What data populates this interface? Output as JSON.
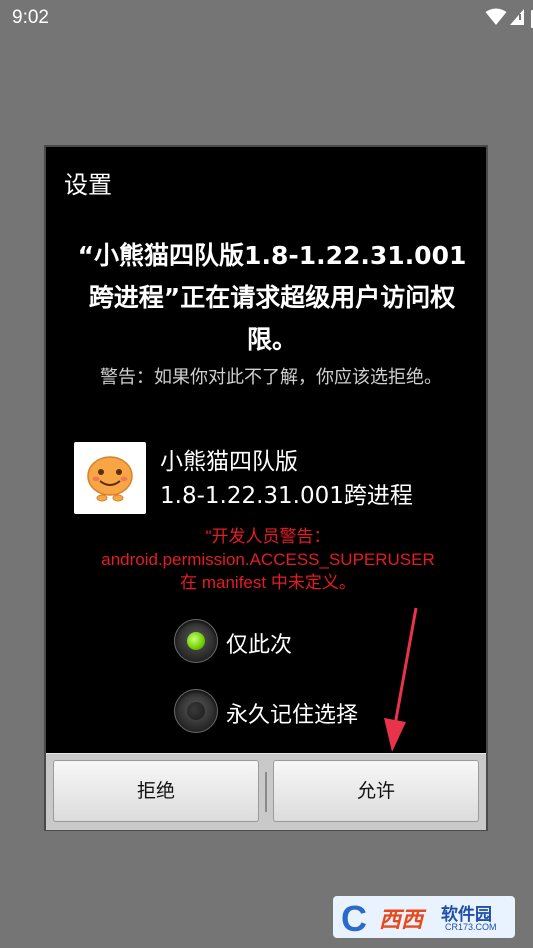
{
  "status_bar": {
    "time": "9:02",
    "icons": [
      "wifi-icon",
      "signal-icon",
      "battery-charging-icon"
    ]
  },
  "dialog": {
    "title": "设置",
    "request_text": "“小熊猫四队版1.8-1.22.31.001跨进程”正在请求超级用户访问权限。",
    "warning_text": "警告：如果你对此不了解，你应该选拒绝。",
    "app": {
      "name_line1": "小熊猫四队版",
      "name_line2": "1.8-1.22.31.001跨进程",
      "icon": "smiley-app-icon"
    },
    "developer_warning": {
      "line1": "\"开发人员警告：",
      "line2": "android.permission.ACCESS_SUPERUSER",
      "line3": "在 manifest 中未定义。"
    },
    "options": [
      {
        "label": "仅此次",
        "selected": true
      },
      {
        "label": "永久记住选择",
        "selected": false
      }
    ],
    "buttons": {
      "deny": "拒绝",
      "allow": "允许"
    }
  },
  "watermark": {
    "letter": "C",
    "site_glyph": "西西",
    "name": "软件园",
    "url": "CR173.COM"
  },
  "colors": {
    "background": "#757575",
    "dialog": "#000000",
    "warning_red": "#e51c23",
    "radio_on": "#6fcf00",
    "arrow": "#e8334a"
  }
}
